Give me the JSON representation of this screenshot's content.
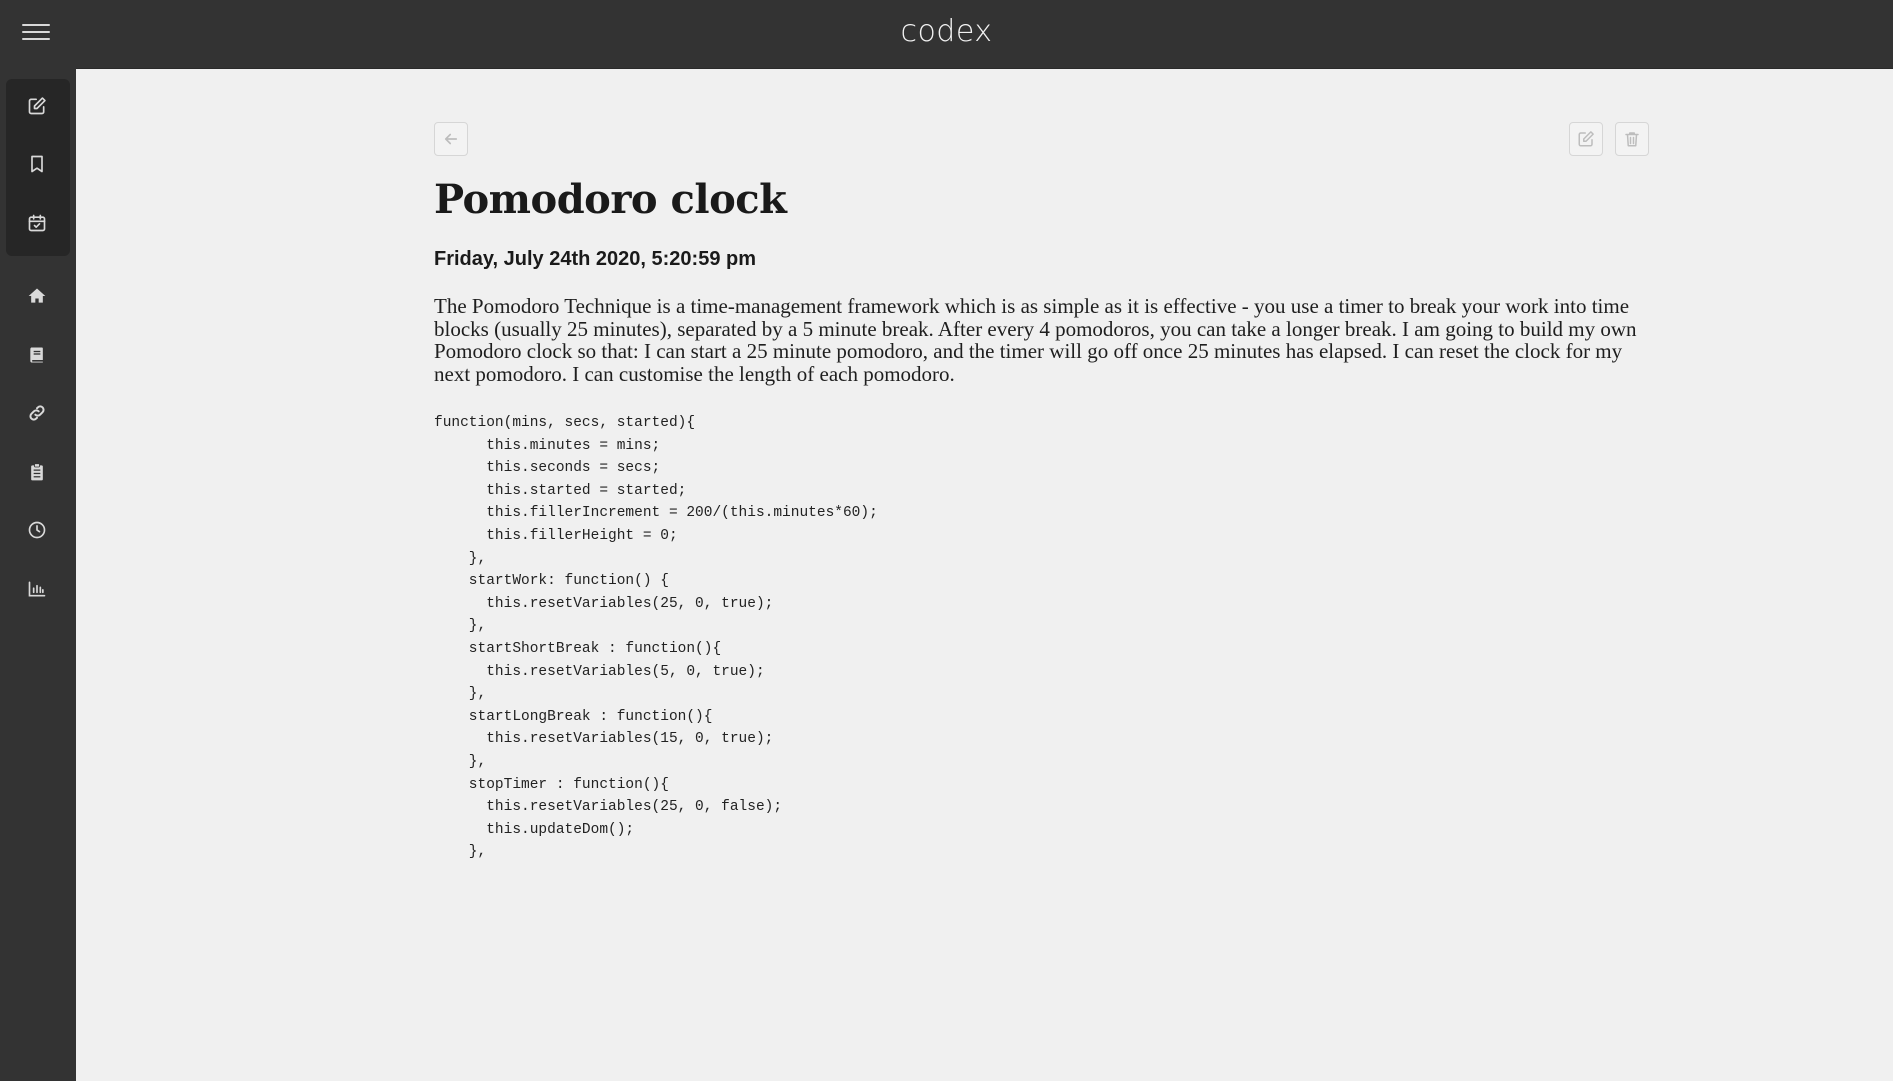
{
  "app": {
    "brand": "codex"
  },
  "sidebar": {
    "top_items": [
      {
        "icon": "edit-icon"
      },
      {
        "icon": "bookmark-icon"
      },
      {
        "icon": "calendar-check-icon"
      }
    ],
    "items": [
      {
        "icon": "home-icon"
      },
      {
        "icon": "book-icon"
      },
      {
        "icon": "link-icon"
      },
      {
        "icon": "clipboard-icon"
      },
      {
        "icon": "clock-icon"
      },
      {
        "icon": "bar-chart-icon"
      }
    ]
  },
  "toolbar": {
    "back_icon": "arrow-left-icon",
    "edit_icon": "edit-icon",
    "delete_icon": "trash-icon"
  },
  "entry": {
    "title": "Pomodoro clock",
    "date": "Friday, July 24th 2020, 5:20:59 pm",
    "description": "The Pomodoro Technique is a time-management framework which is as simple as it is effective - you use a timer to break your work into time blocks (usually 25 minutes), separated by a 5 minute break. After every 4 pomodoros, you can take a longer break. I am going to build my own Pomodoro clock so that: I can start a 25 minute pomodoro, and the timer will go off once 25 minutes has elapsed. I can reset the clock for my next pomodoro. I can customise the length of each pomodoro.",
    "code": "function(mins, secs, started){\n      this.minutes = mins;\n      this.seconds = secs;\n      this.started = started;\n      this.fillerIncrement = 200/(this.minutes*60);\n      this.fillerHeight = 0;\n    },\n    startWork: function() {\n      this.resetVariables(25, 0, true);\n    },\n    startShortBreak : function(){\n      this.resetVariables(5, 0, true);\n    },\n    startLongBreak : function(){\n      this.resetVariables(15, 0, true);\n    },\n    stopTimer : function(){\n      this.resetVariables(25, 0, false);\n      this.updateDom();\n    },"
  },
  "colors": {
    "topbar": "#333333",
    "sidebar": "#333333",
    "sidebar_group": "#262626",
    "background": "#f0f0f0",
    "icon": "#d9d9d9"
  }
}
